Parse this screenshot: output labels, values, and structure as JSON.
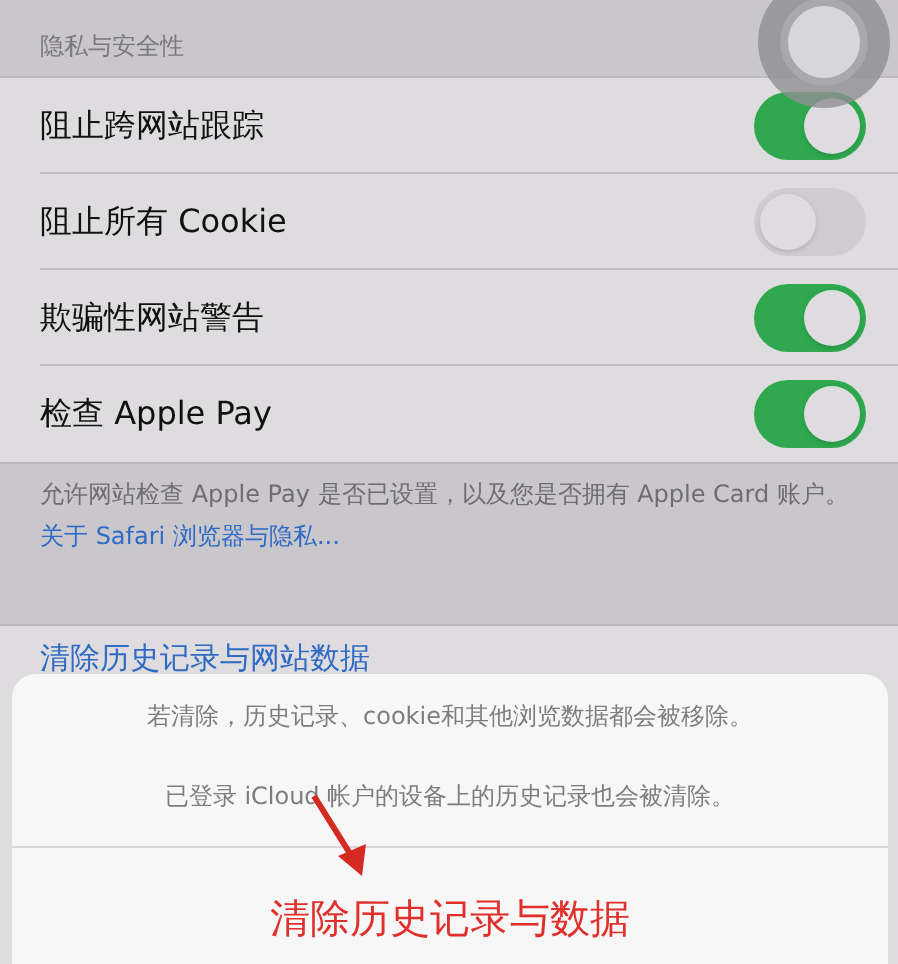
{
  "section_header": "隐私与安全性",
  "toggles": [
    {
      "label": "阻止跨网站跟踪",
      "on": true
    },
    {
      "label": "阻止所有 Cookie",
      "on": false
    },
    {
      "label": "欺骗性网站警告",
      "on": true
    },
    {
      "label": "检查 Apple Pay",
      "on": true
    }
  ],
  "footer": {
    "text": "允许网站检查 Apple Pay 是否已设置，以及您是否拥有 Apple Card 账户。",
    "link": "关于 Safari 浏览器与隐私..."
  },
  "clear_row": "清除历史记录与网站数据",
  "action_sheet": {
    "messages": [
      "若清除，历史记录、cookie和其他浏览数据都会被移除。",
      "已登录 iCloud 帐户的设备上的历史记录也会被清除。"
    ],
    "action": "清除历史记录与数据"
  }
}
